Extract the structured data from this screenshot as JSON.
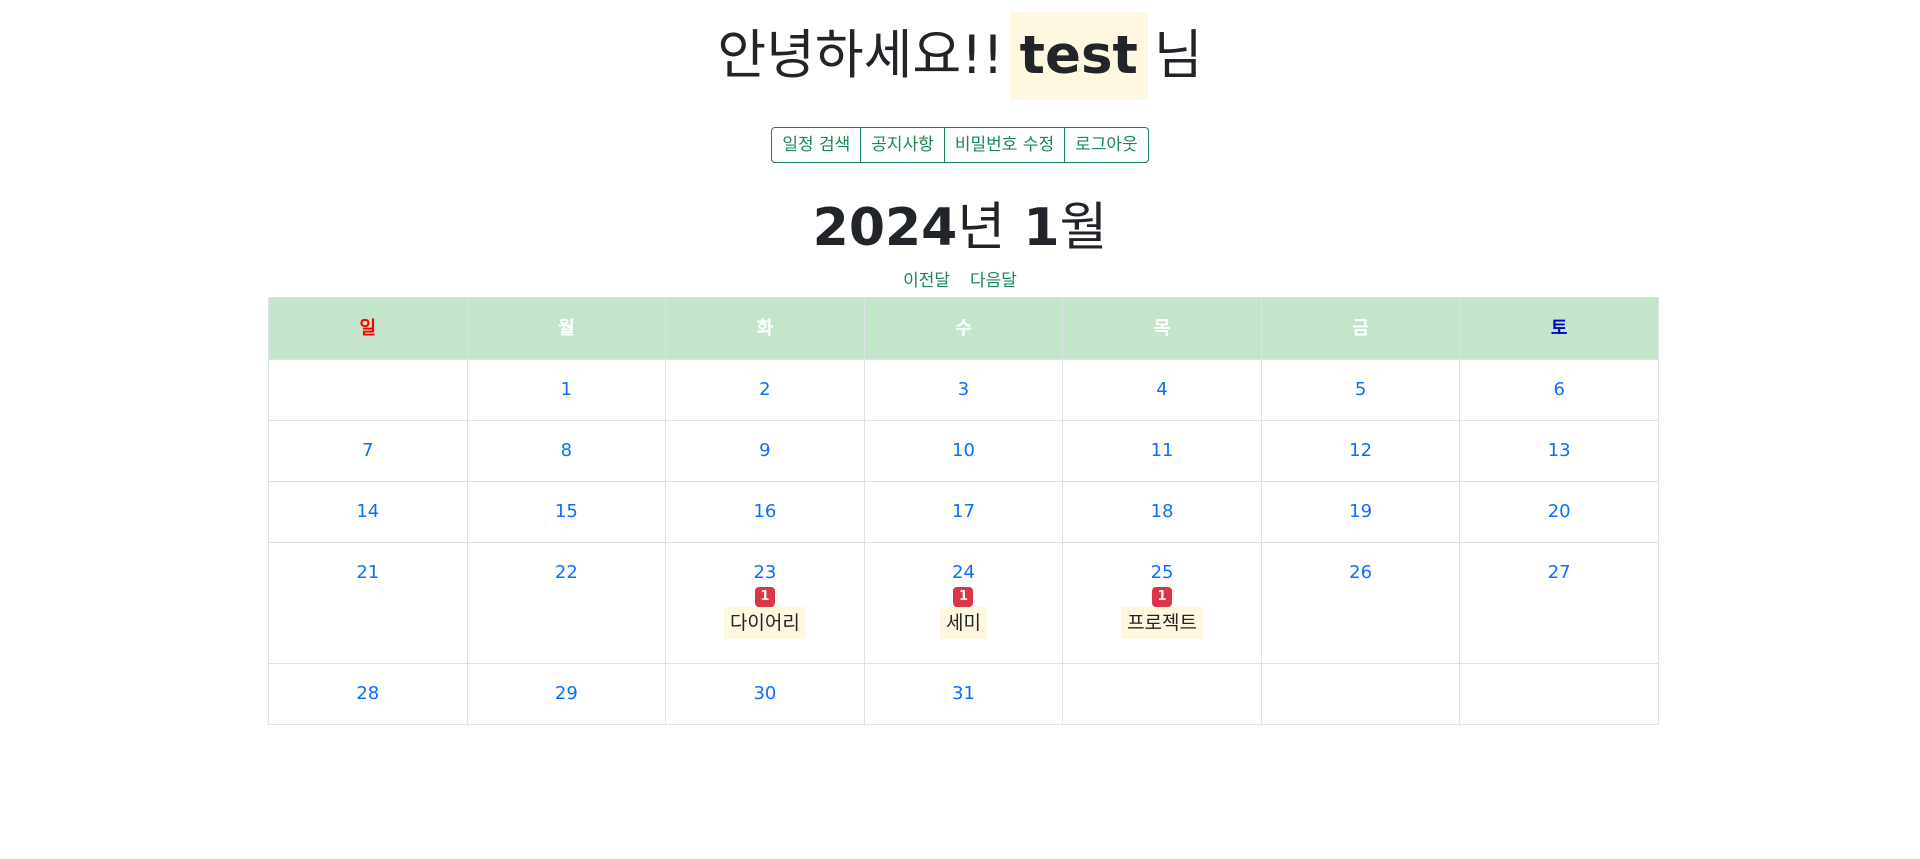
{
  "header": {
    "greeting_prefix": "안녕하세요!!",
    "username": "test",
    "greeting_suffix": "님"
  },
  "nav_buttons": [
    "일정 검색",
    "공지사항",
    "비밀번호 수정",
    "로그아웃"
  ],
  "calendar": {
    "year": "2024",
    "year_unit": "년",
    "month": "1",
    "month_unit": "월",
    "prev_label": "이전달",
    "next_label": "다음달",
    "weekdays": [
      "일",
      "월",
      "화",
      "수",
      "목",
      "금",
      "토"
    ],
    "weeks": [
      [
        {
          "day": ""
        },
        {
          "day": "1"
        },
        {
          "day": "2"
        },
        {
          "day": "3"
        },
        {
          "day": "4"
        },
        {
          "day": "5"
        },
        {
          "day": "6"
        }
      ],
      [
        {
          "day": "7"
        },
        {
          "day": "8"
        },
        {
          "day": "9"
        },
        {
          "day": "10"
        },
        {
          "day": "11"
        },
        {
          "day": "12"
        },
        {
          "day": "13"
        }
      ],
      [
        {
          "day": "14"
        },
        {
          "day": "15"
        },
        {
          "day": "16"
        },
        {
          "day": "17"
        },
        {
          "day": "18"
        },
        {
          "day": "19"
        },
        {
          "day": "20"
        }
      ],
      [
        {
          "day": "21"
        },
        {
          "day": "22"
        },
        {
          "day": "23",
          "count": "1",
          "event": "다이어리"
        },
        {
          "day": "24",
          "count": "1",
          "event": "세미"
        },
        {
          "day": "25",
          "count": "1",
          "event": "프로젝트"
        },
        {
          "day": "26"
        },
        {
          "day": "27"
        }
      ],
      [
        {
          "day": "28"
        },
        {
          "day": "29"
        },
        {
          "day": "30"
        },
        {
          "day": "31"
        },
        {
          "day": ""
        },
        {
          "day": ""
        },
        {
          "day": ""
        }
      ]
    ]
  },
  "colors": {
    "accent_green": "#198754",
    "header_bg": "#c3e6cb",
    "day_link": "#0d6efd",
    "badge": "#dc3545",
    "highlight": "#fff8e1",
    "sunday": "#ff0000",
    "saturday": "#0000cd"
  }
}
